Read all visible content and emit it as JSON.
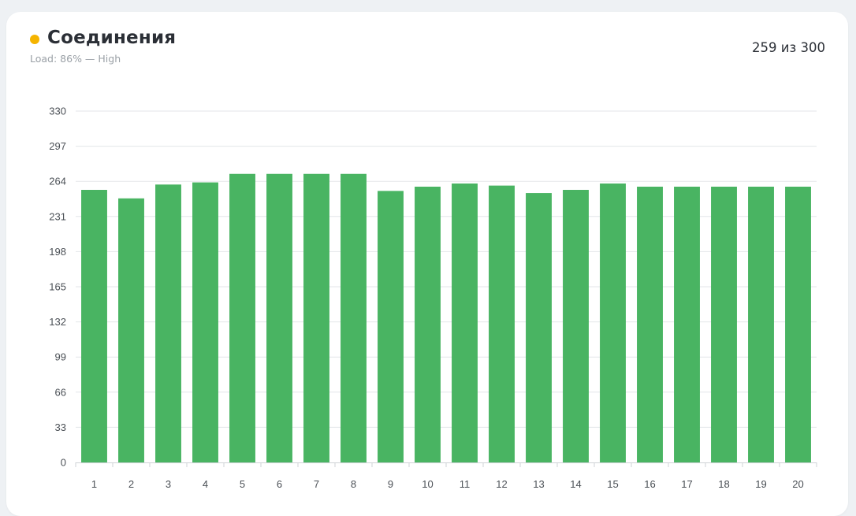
{
  "card": {
    "title": "Соединения",
    "subtitle": "Load: 86% — High",
    "count": "259 из 300",
    "status_color": "#f5b400"
  },
  "colors": {
    "bar": "#49b462",
    "grid": "#e3e6e9",
    "axis": "#cfd3d7"
  },
  "chart_data": {
    "type": "bar",
    "categories": [
      "1",
      "2",
      "3",
      "4",
      "5",
      "6",
      "7",
      "8",
      "9",
      "10",
      "11",
      "12",
      "13",
      "14",
      "15",
      "16",
      "17",
      "18",
      "19",
      "20"
    ],
    "values": [
      256,
      248,
      261,
      263,
      271,
      271,
      271,
      271,
      255,
      259,
      262,
      260,
      253,
      256,
      262,
      259,
      259,
      259,
      259,
      259
    ],
    "yticks": [
      0,
      33,
      66,
      99,
      132,
      165,
      198,
      231,
      264,
      297,
      330
    ],
    "ylim": [
      0,
      330
    ],
    "grid": true,
    "legend": "none",
    "title": "",
    "xlabel": "",
    "ylabel": ""
  }
}
